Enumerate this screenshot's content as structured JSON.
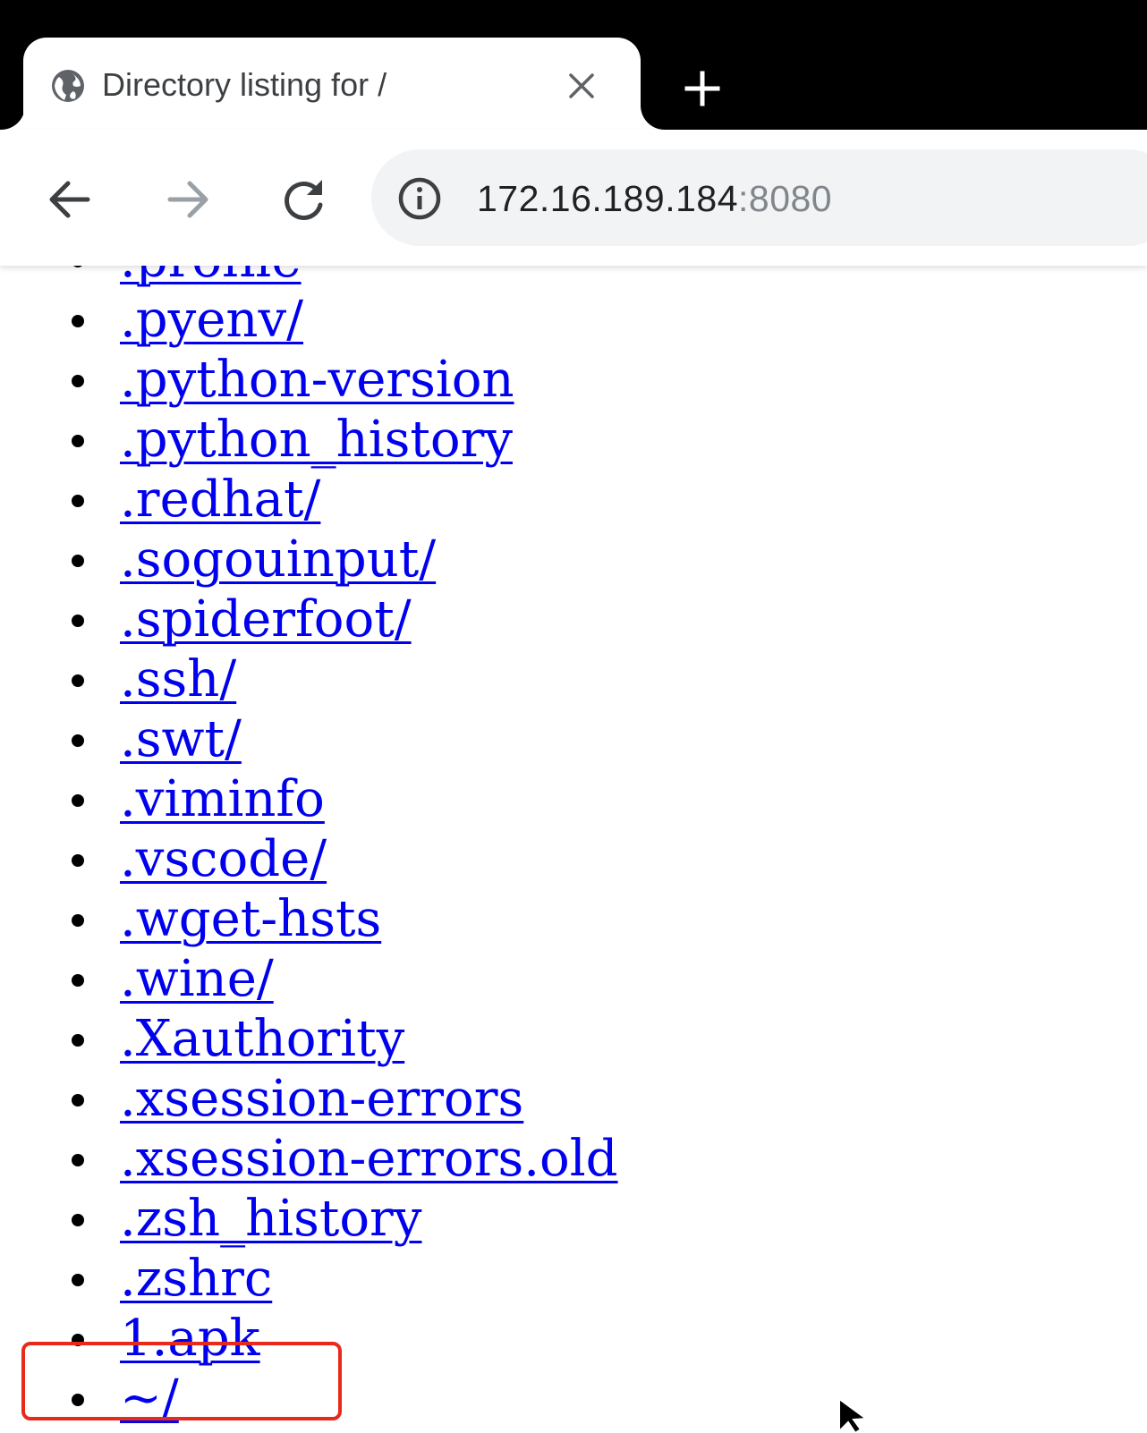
{
  "tab": {
    "title": "Directory listing for /",
    "globe_icon": "globe-icon",
    "close_icon": "close-icon",
    "new_tab_icon": "plus-icon"
  },
  "toolbar": {
    "back_icon": "arrow-left-icon",
    "forward_icon": "arrow-right-icon",
    "reload_icon": "reload-icon",
    "info_icon": "info-icon",
    "url_host": "172.16.189.184",
    "url_port": ":8080"
  },
  "listing": {
    "items": [
      ".profile",
      ".pyenv/",
      ".python-version",
      ".python_history",
      ".redhat/",
      ".sogouinput/",
      ".spiderfoot/",
      ".ssh/",
      ".swt/",
      ".viminfo",
      ".vscode/",
      ".wget-hsts",
      ".wine/",
      ".Xauthority",
      ".xsession-errors",
      ".xsession-errors.old",
      ".zsh_history",
      ".zshrc",
      "1.apk",
      "~/"
    ]
  },
  "annotation": {
    "highlight_color": "#e8291c",
    "highlighted_item": "1.apk"
  },
  "colors": {
    "link": "#0000ee",
    "tabstrip": "#000000",
    "omnibox": "#f1f3f4"
  }
}
